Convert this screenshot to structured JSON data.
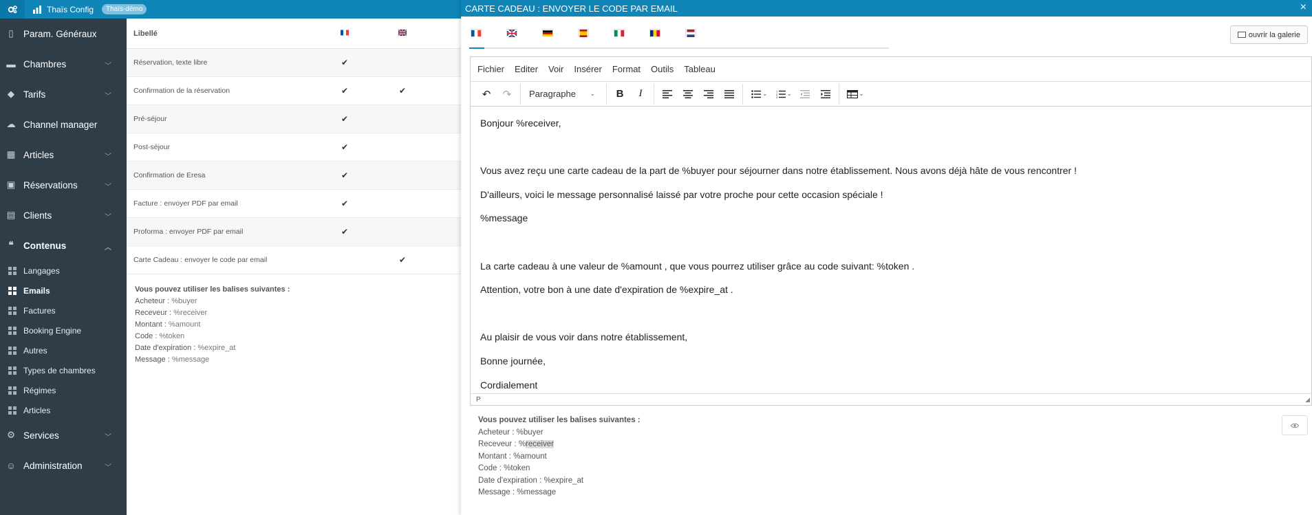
{
  "topbar": {
    "brand": "Thaïs Config",
    "badge": "Thaïs-démo"
  },
  "sidebar": {
    "items": [
      {
        "label": "Param. Généraux",
        "icon": "building-icon",
        "chevron": false
      },
      {
        "label": "Chambres",
        "icon": "bed-icon",
        "chevron": true
      },
      {
        "label": "Tarifs",
        "icon": "tag-icon",
        "chevron": true
      },
      {
        "label": "Channel manager",
        "icon": "cloud-icon",
        "chevron": false
      },
      {
        "label": "Articles",
        "icon": "store-icon",
        "chevron": true
      },
      {
        "label": "Réservations",
        "icon": "calendar-icon",
        "chevron": true
      },
      {
        "label": "Clients",
        "icon": "contact-icon",
        "chevron": true
      },
      {
        "label": "Contenus",
        "icon": "quote-icon",
        "chevron": true,
        "expanded": true
      }
    ],
    "subitems": [
      {
        "label": "Langages"
      },
      {
        "label": "Emails",
        "active": true
      },
      {
        "label": "Factures"
      },
      {
        "label": "Booking Engine"
      },
      {
        "label": "Autres"
      },
      {
        "label": "Types de chambres"
      },
      {
        "label": "Régimes"
      },
      {
        "label": "Articles"
      }
    ],
    "bottom_items": [
      {
        "label": "Services",
        "icon": "gear-icon",
        "chevron": true
      },
      {
        "label": "Administration",
        "icon": "user-gear-icon",
        "chevron": true
      }
    ]
  },
  "table": {
    "header": {
      "label": "Libellé"
    },
    "rows": [
      {
        "label": "Réservation, texte libre",
        "fr": true,
        "gb": false
      },
      {
        "label": "Confirmation de la réservation",
        "fr": true,
        "gb": true
      },
      {
        "label": "Pré-séjour",
        "fr": true,
        "gb": false
      },
      {
        "label": "Post-séjour",
        "fr": true,
        "gb": false
      },
      {
        "label": "Confirmation de Eresa",
        "fr": true,
        "gb": false
      },
      {
        "label": "Facture : envoyer PDF par email",
        "fr": true,
        "gb": false
      },
      {
        "label": "Proforma : envoyer PDF par email",
        "fr": true,
        "gb": false
      },
      {
        "label": "Carte Cadeau : envoyer le code par email",
        "fr": false,
        "gb": true
      }
    ]
  },
  "tags": {
    "title": "Vous pouvez utiliser les balises suivantes :",
    "items": [
      {
        "label": "Acheteur :",
        "value": "%buyer"
      },
      {
        "label": "Receveur :",
        "value": "%receiver"
      },
      {
        "label": "Montant :",
        "value": "%amount"
      },
      {
        "label": "Code :",
        "value": "%token"
      },
      {
        "label": "Date d'expiration :",
        "value": "%expire_at"
      },
      {
        "label": "Message :",
        "value": "%message"
      }
    ]
  },
  "dialog": {
    "title": "CARTE CADEAU : ENVOYER LE CODE PAR EMAIL",
    "close": "×",
    "gallery_button": "ouvrir la galerie",
    "flags": [
      "fr",
      "gb",
      "de",
      "es",
      "it",
      "ro",
      "nl"
    ],
    "menu": [
      "Fichier",
      "Editer",
      "Voir",
      "Insérer",
      "Format",
      "Outils",
      "Tableau"
    ],
    "format_select": "Paragraphe",
    "content": [
      "Bonjour %receiver,",
      "",
      "Vous avez reçu une carte cadeau de la part de %buyer pour séjourner dans notre établissement. Nous avons déjà hâte de vous rencontrer !",
      "D'ailleurs, voici le message personnalisé laissé par votre proche pour cette occasion spéciale !",
      "%message",
      "",
      "La carte cadeau à une valeur de %amount , que vous pourrez utiliser grâce au code suivant: %token .",
      "Attention, votre bon à une date d'expiration de %expire_at .",
      "",
      "Au plaisir de vous voir dans notre établissement,",
      "Bonne journée,",
      "Cordialement"
    ],
    "statusbar": "P",
    "tags": {
      "title": "Vous pouvez utiliser les balises suivantes :",
      "items": [
        {
          "label": "Acheteur :",
          "value": "%buyer"
        },
        {
          "label": "Receveur :",
          "value_prefix": "%",
          "value_highlight": "receiver"
        },
        {
          "label": "Montant :",
          "value": "%amount"
        },
        {
          "label": "Code :",
          "value": "%token"
        },
        {
          "label": "Date d'expiration :",
          "value": "%expire_at"
        },
        {
          "label": "Message :",
          "value": "%message"
        }
      ]
    }
  },
  "colors": {
    "primary": "#0f85b8",
    "sidebar": "#2f3d48"
  }
}
